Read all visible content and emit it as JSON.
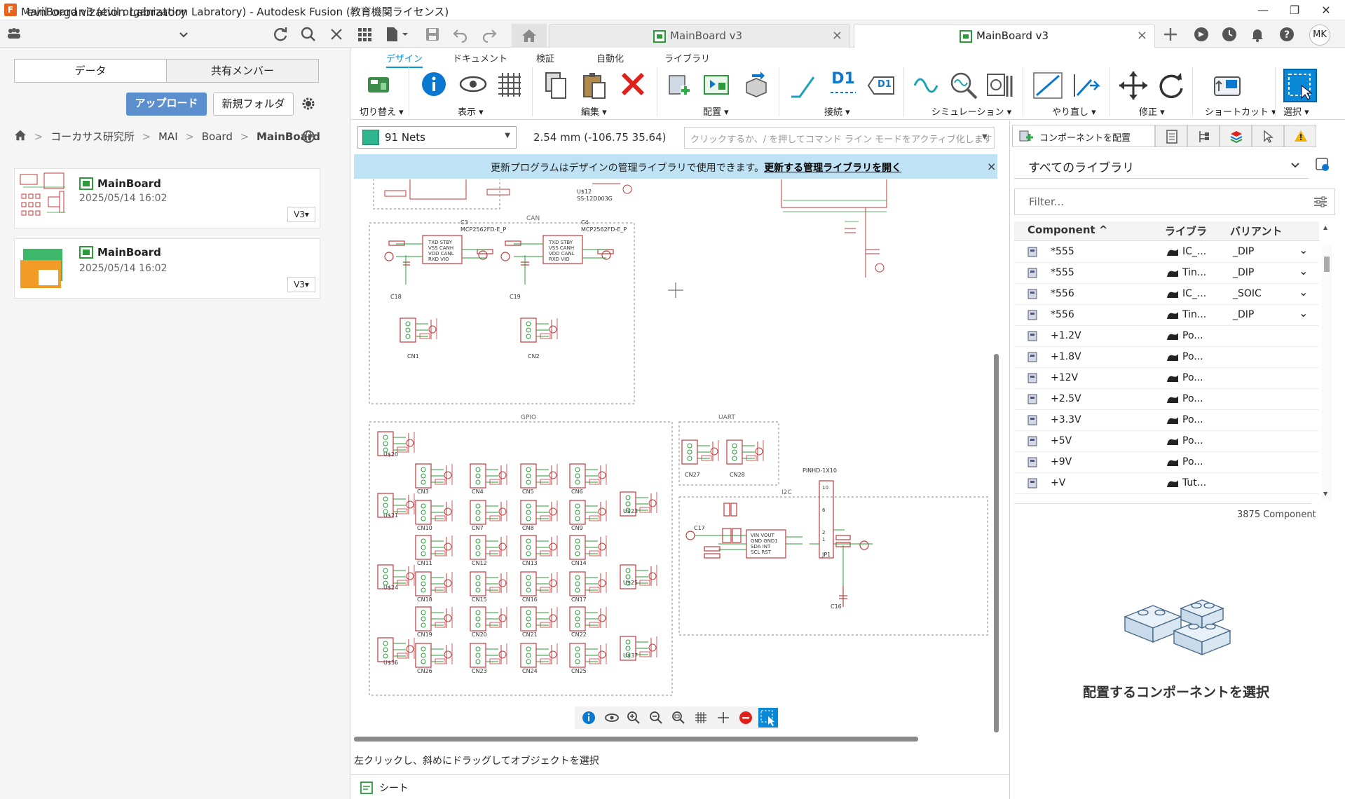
{
  "window": {
    "title": "MainBoard v3 (evil organization Labratory) - Autodesk Fusion (教育機関ライセンス)",
    "minimize": "—",
    "maximize": "❐",
    "close": "✕"
  },
  "topbar": {
    "team_name": "evil organization Labratory",
    "tabs": [
      {
        "label": "MainBoard v3",
        "active": false
      },
      {
        "label": "MainBoard v3",
        "active": true
      }
    ],
    "user_initials": "MK"
  },
  "leftpanel": {
    "seg_data": "データ",
    "seg_members": "共有メンバー",
    "upload_label": "アップロード",
    "new_folder_label": "新規フォルダ",
    "breadcrumb": [
      "コーカサス研究所",
      "MAI",
      "Board",
      "MainBoard"
    ],
    "files": [
      {
        "title": "MainBoard",
        "date": "2025/05/14 16:02",
        "version": "V3▾"
      },
      {
        "title": "MainBoard",
        "date": "2025/05/14 16:02",
        "version": "V3▾"
      }
    ]
  },
  "ribbon": {
    "tabs": [
      "デザイン",
      "ドキュメント",
      "検証",
      "自動化",
      "ライブラリ"
    ],
    "groups": [
      "切り替え ▾",
      "表示 ▾",
      "編集 ▾",
      "配置 ▾",
      "接続 ▾",
      "シミュレーション ▾",
      "やり直し ▾",
      "修正 ▾",
      "ショートカット ▾",
      "選択 ▾"
    ],
    "d1_a": "D1",
    "d1_b": "D1"
  },
  "command": {
    "net_select": "91 Nets",
    "coord": "2.54 mm (-106.75 35.64)",
    "input_placeholder": "クリックするか、/ を押してコマンド ライン モードをアクティブ化します"
  },
  "banner": {
    "text": "更新プログラムはデザインの管理ライブラリで使用できます。",
    "link": "更新する管理ライブラリを開く",
    "close": "×"
  },
  "status": {
    "hint": "左クリックし、斜めにドラッグしてオブジェクトを選択",
    "sheet": "シート"
  },
  "schematic": {
    "frames": [
      "CAN",
      "GPIO",
      "UART",
      "I2C"
    ],
    "labels": [
      "C3",
      "MCP2562FD-E_P",
      "C4",
      "MCP2562FD-E_P",
      "C18",
      "C19",
      "CN1",
      "CN2",
      "U$12",
      "SS-12D003G",
      "PINHD-1X10",
      "JP1",
      "C16",
      "C17",
      "CN27",
      "CN28",
      "U$20",
      "U$21",
      "U$24",
      "U$36",
      "U$23",
      "U$25",
      "U$37"
    ],
    "cn_grid": [
      "CN3",
      "CN4",
      "CN5",
      "CN6",
      "CN10",
      "CN7",
      "CN8",
      "CN9",
      "CN11",
      "CN12",
      "CN13",
      "CN14",
      "CN18",
      "CN15",
      "CN16",
      "CN17",
      "CN19",
      "CN20",
      "CN21",
      "CN22",
      "CN26",
      "CN23",
      "CN24",
      "CN25"
    ]
  },
  "rightpanel": {
    "place_tab": "コンポーネントを配置",
    "library_select": "すべてのライブラリ",
    "filter_placeholder": "Filter...",
    "headers": [
      "Component ^",
      "ライブラ",
      "バリアント"
    ],
    "rows": [
      {
        "name": "*555",
        "lib": "IC_...",
        "variant": "_DIP",
        "expand": "⌄"
      },
      {
        "name": "*555",
        "lib": "Tin...",
        "variant": "_DIP",
        "expand": "⌄"
      },
      {
        "name": "*556",
        "lib": "IC_...",
        "variant": "_SOIC",
        "expand": "⌄"
      },
      {
        "name": "*556",
        "lib": "Tin...",
        "variant": "_DIP",
        "expand": "⌄"
      },
      {
        "name": "+1.2V",
        "lib": "Po...",
        "variant": "",
        "expand": ""
      },
      {
        "name": "+1.8V",
        "lib": "Po...",
        "variant": "",
        "expand": ""
      },
      {
        "name": "+12V",
        "lib": "Po...",
        "variant": "",
        "expand": ""
      },
      {
        "name": "+2.5V",
        "lib": "Po...",
        "variant": "",
        "expand": ""
      },
      {
        "name": "+3.3V",
        "lib": "Po...",
        "variant": "",
        "expand": ""
      },
      {
        "name": "+5V",
        "lib": "Po...",
        "variant": "",
        "expand": ""
      },
      {
        "name": "+9V",
        "lib": "Po...",
        "variant": "",
        "expand": ""
      },
      {
        "name": "+V",
        "lib": "Tut...",
        "variant": "",
        "expand": ""
      }
    ],
    "count": "3875 Component",
    "empty_state": "配置するコンポーネントを選択"
  },
  "colors": {
    "accent": "#0696d7",
    "net_color": "#2fb58d",
    "schematic_red": "#c0393b",
    "schematic_green": "#2a9a3a"
  }
}
